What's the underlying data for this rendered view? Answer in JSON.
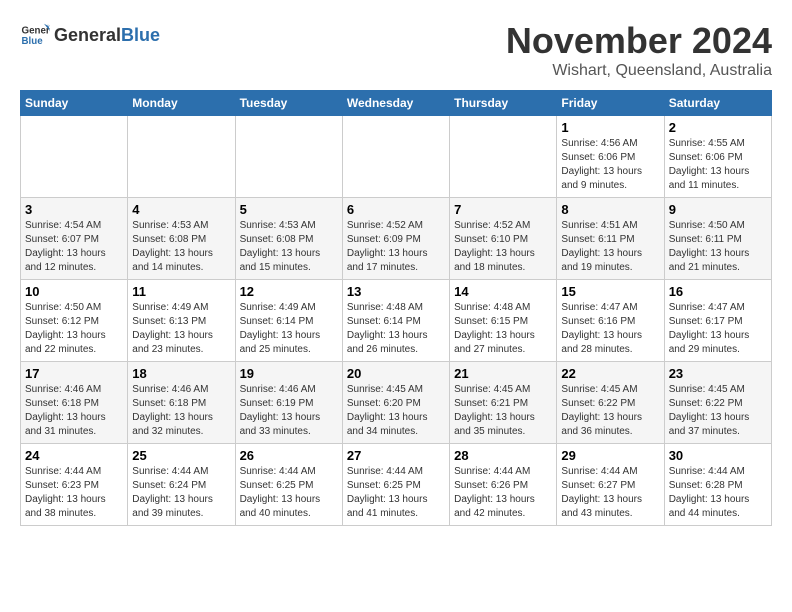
{
  "logo": {
    "text_general": "General",
    "text_blue": "Blue"
  },
  "title": "November 2024",
  "subtitle": "Wishart, Queensland, Australia",
  "days_header": [
    "Sunday",
    "Monday",
    "Tuesday",
    "Wednesday",
    "Thursday",
    "Friday",
    "Saturday"
  ],
  "weeks": [
    [
      {
        "day": "",
        "info": ""
      },
      {
        "day": "",
        "info": ""
      },
      {
        "day": "",
        "info": ""
      },
      {
        "day": "",
        "info": ""
      },
      {
        "day": "",
        "info": ""
      },
      {
        "day": "1",
        "info": "Sunrise: 4:56 AM\nSunset: 6:06 PM\nDaylight: 13 hours\nand 9 minutes."
      },
      {
        "day": "2",
        "info": "Sunrise: 4:55 AM\nSunset: 6:06 PM\nDaylight: 13 hours\nand 11 minutes."
      }
    ],
    [
      {
        "day": "3",
        "info": "Sunrise: 4:54 AM\nSunset: 6:07 PM\nDaylight: 13 hours\nand 12 minutes."
      },
      {
        "day": "4",
        "info": "Sunrise: 4:53 AM\nSunset: 6:08 PM\nDaylight: 13 hours\nand 14 minutes."
      },
      {
        "day": "5",
        "info": "Sunrise: 4:53 AM\nSunset: 6:08 PM\nDaylight: 13 hours\nand 15 minutes."
      },
      {
        "day": "6",
        "info": "Sunrise: 4:52 AM\nSunset: 6:09 PM\nDaylight: 13 hours\nand 17 minutes."
      },
      {
        "day": "7",
        "info": "Sunrise: 4:52 AM\nSunset: 6:10 PM\nDaylight: 13 hours\nand 18 minutes."
      },
      {
        "day": "8",
        "info": "Sunrise: 4:51 AM\nSunset: 6:11 PM\nDaylight: 13 hours\nand 19 minutes."
      },
      {
        "day": "9",
        "info": "Sunrise: 4:50 AM\nSunset: 6:11 PM\nDaylight: 13 hours\nand 21 minutes."
      }
    ],
    [
      {
        "day": "10",
        "info": "Sunrise: 4:50 AM\nSunset: 6:12 PM\nDaylight: 13 hours\nand 22 minutes."
      },
      {
        "day": "11",
        "info": "Sunrise: 4:49 AM\nSunset: 6:13 PM\nDaylight: 13 hours\nand 23 minutes."
      },
      {
        "day": "12",
        "info": "Sunrise: 4:49 AM\nSunset: 6:14 PM\nDaylight: 13 hours\nand 25 minutes."
      },
      {
        "day": "13",
        "info": "Sunrise: 4:48 AM\nSunset: 6:14 PM\nDaylight: 13 hours\nand 26 minutes."
      },
      {
        "day": "14",
        "info": "Sunrise: 4:48 AM\nSunset: 6:15 PM\nDaylight: 13 hours\nand 27 minutes."
      },
      {
        "day": "15",
        "info": "Sunrise: 4:47 AM\nSunset: 6:16 PM\nDaylight: 13 hours\nand 28 minutes."
      },
      {
        "day": "16",
        "info": "Sunrise: 4:47 AM\nSunset: 6:17 PM\nDaylight: 13 hours\nand 29 minutes."
      }
    ],
    [
      {
        "day": "17",
        "info": "Sunrise: 4:46 AM\nSunset: 6:18 PM\nDaylight: 13 hours\nand 31 minutes."
      },
      {
        "day": "18",
        "info": "Sunrise: 4:46 AM\nSunset: 6:18 PM\nDaylight: 13 hours\nand 32 minutes."
      },
      {
        "day": "19",
        "info": "Sunrise: 4:46 AM\nSunset: 6:19 PM\nDaylight: 13 hours\nand 33 minutes."
      },
      {
        "day": "20",
        "info": "Sunrise: 4:45 AM\nSunset: 6:20 PM\nDaylight: 13 hours\nand 34 minutes."
      },
      {
        "day": "21",
        "info": "Sunrise: 4:45 AM\nSunset: 6:21 PM\nDaylight: 13 hours\nand 35 minutes."
      },
      {
        "day": "22",
        "info": "Sunrise: 4:45 AM\nSunset: 6:22 PM\nDaylight: 13 hours\nand 36 minutes."
      },
      {
        "day": "23",
        "info": "Sunrise: 4:45 AM\nSunset: 6:22 PM\nDaylight: 13 hours\nand 37 minutes."
      }
    ],
    [
      {
        "day": "24",
        "info": "Sunrise: 4:44 AM\nSunset: 6:23 PM\nDaylight: 13 hours\nand 38 minutes."
      },
      {
        "day": "25",
        "info": "Sunrise: 4:44 AM\nSunset: 6:24 PM\nDaylight: 13 hours\nand 39 minutes."
      },
      {
        "day": "26",
        "info": "Sunrise: 4:44 AM\nSunset: 6:25 PM\nDaylight: 13 hours\nand 40 minutes."
      },
      {
        "day": "27",
        "info": "Sunrise: 4:44 AM\nSunset: 6:25 PM\nDaylight: 13 hours\nand 41 minutes."
      },
      {
        "day": "28",
        "info": "Sunrise: 4:44 AM\nSunset: 6:26 PM\nDaylight: 13 hours\nand 42 minutes."
      },
      {
        "day": "29",
        "info": "Sunrise: 4:44 AM\nSunset: 6:27 PM\nDaylight: 13 hours\nand 43 minutes."
      },
      {
        "day": "30",
        "info": "Sunrise: 4:44 AM\nSunset: 6:28 PM\nDaylight: 13 hours\nand 44 minutes."
      }
    ]
  ]
}
